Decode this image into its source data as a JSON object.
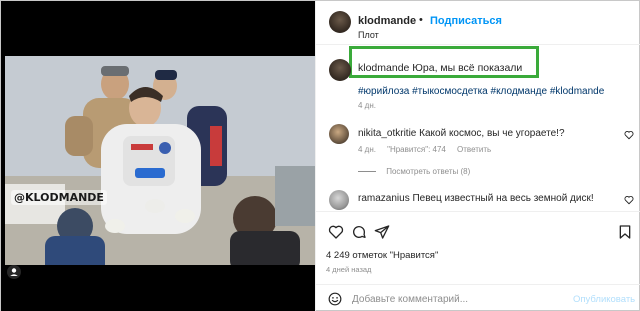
{
  "post": {
    "author": "klodmande",
    "dot": "•",
    "follow_label": "Подписаться",
    "location": "Плот",
    "watermark": "@KLODMANDE",
    "caption": {
      "username": "klodmande",
      "text": "Юра, мы всё показали",
      "hashtags": "#юрийлоза #тыкосмосдетка #клодманде #klodmande",
      "time": "4 дн."
    },
    "comments": [
      {
        "username": "nikita_otkritie",
        "text": "Какой космос, вы че угораете!?",
        "time": "4 дн.",
        "likes": "\"Нравится\": 474",
        "reply": "Ответить",
        "view_replies": "Посмотреть ответы (8)"
      },
      {
        "username": "ramazanius",
        "text": "Певец известный на весь земной диск!"
      }
    ],
    "likes_count": "4 249 отметок \"Нравится\"",
    "posted_ago": "4 дней назад",
    "comment_placeholder": "Добавьте комментарий...",
    "publish_label": "Опубликовать"
  },
  "colors": {
    "accent": "#0095f6",
    "highlight_box": "#3aaa3a",
    "publish_disabled": "#b2dffc",
    "hashtag": "#00376b"
  }
}
